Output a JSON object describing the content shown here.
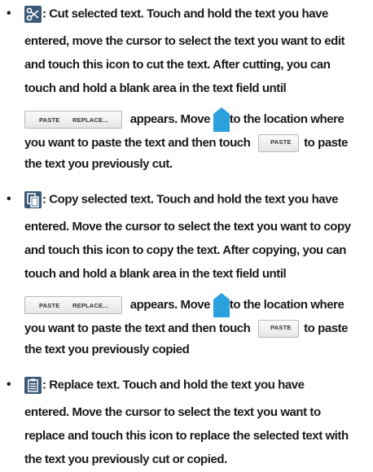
{
  "items": [
    {
      "icon": "cut-icon",
      "lines": {
        "l1": ": Cut selected text. Touch and hold the text you have",
        "l2": "entered, move the cursor to select the text you want to edit",
        "l3": "and touch this icon to cut the text. After cutting, you can",
        "l4": "touch and hold a blank area in the text field until",
        "l5_mid": "appears. Move",
        "l5_end": "to the location where",
        "l6_start": "you want to paste the text and then touch",
        "l6_end": "to paste",
        "l7": "the text you previously cut."
      }
    },
    {
      "icon": "copy-icon",
      "lines": {
        "l1": ": Copy selected text. Touch and hold the text you have",
        "l2": "entered. Move the cursor to select the text you want to copy",
        "l3": "and touch this icon to copy the text. After copying, you can",
        "l4": "touch and hold a blank area in the text field until",
        "l5_mid": "appears. Move",
        "l5_end": "to the location where",
        "l6_start": "you want to paste the text and then touch",
        "l6_end": "to paste",
        "l7": "the text you previously copied"
      }
    },
    {
      "icon": "clipboard-icon",
      "lines": {
        "l1": ": Replace text. Touch and hold the text you have",
        "l2": "entered. Move the cursor to select the text you want to",
        "l3": "replace and touch this icon to replace the selected text with",
        "l4": "the text you previously cut or copied."
      }
    }
  ],
  "popup": {
    "paste_label": "PASTE",
    "replace_label": "REPLACE..."
  },
  "bullet_char": "•",
  "colors": {
    "icon_bg": "#3a5a78",
    "handle": "#2aa0dc",
    "text": "#1a1a1a"
  }
}
